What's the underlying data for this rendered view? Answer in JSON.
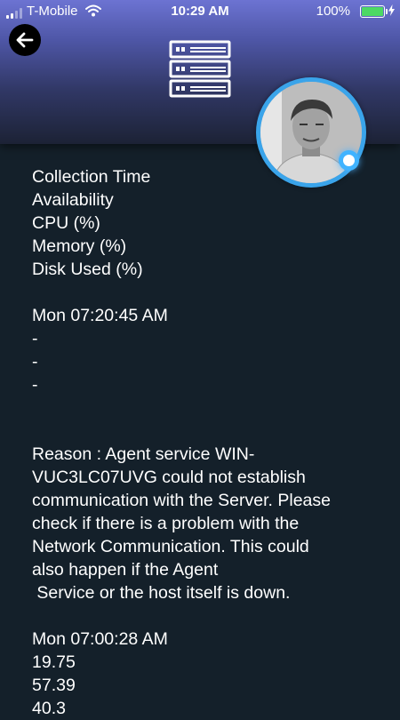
{
  "status_bar": {
    "carrier": "T-Mobile",
    "time": "10:29 AM",
    "battery": "100%",
    "battery_level": 1.0,
    "icons": [
      "signal-icon",
      "wifi-icon",
      "battery-icon",
      "charging-bolt-icon"
    ]
  },
  "header": {
    "back_icon": "arrow-left-icon",
    "device_icon": "server-rack-icon",
    "avatar_status_color": "#40b3ff"
  },
  "fields": {
    "labels": [
      "Collection Time",
      "Availability",
      "CPU (%)",
      "Memory (%)",
      "Disk Used (%)"
    ]
  },
  "records": [
    {
      "time": "Mon 07:20:45 AM",
      "availability": "-",
      "cpu": "-",
      "memory": "-",
      "reason_lines": [
        "Reason : Agent service WIN-",
        "VUC3LC07UVG could not establish",
        "communication with the Server. Please",
        "check if there is a problem with the",
        "Network Communication. This could",
        "also happen if the Agent",
        " Service or the host itself is down."
      ]
    },
    {
      "time": "Mon 07:00:28 AM",
      "availability": "19.75",
      "cpu": "57.39",
      "memory": "40.3"
    }
  ]
}
